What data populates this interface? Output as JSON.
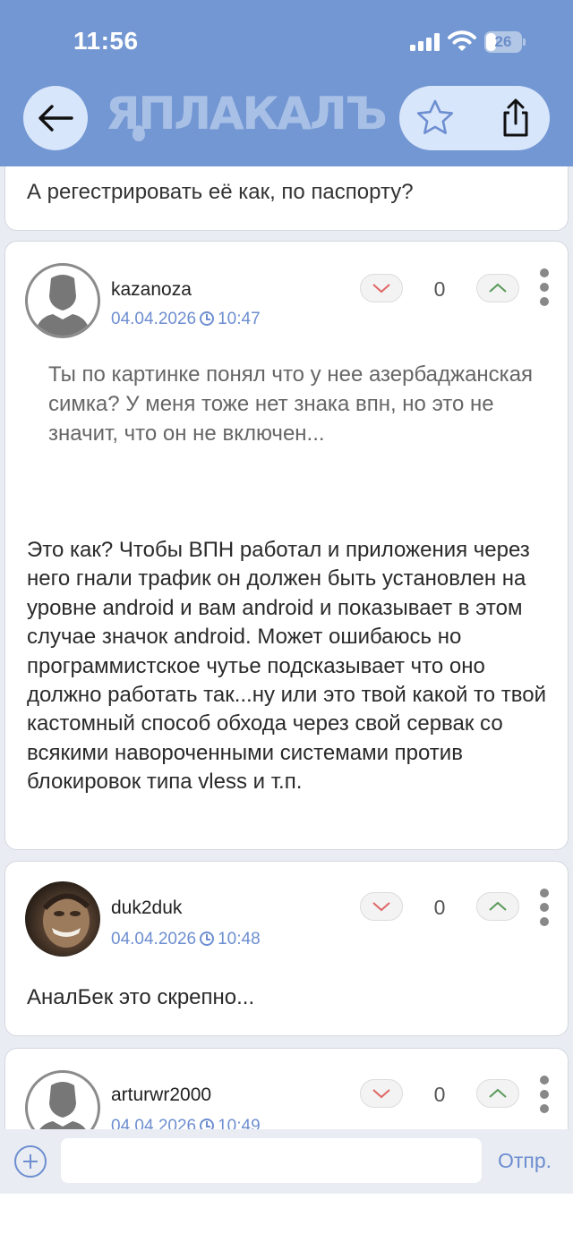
{
  "status_bar": {
    "time": "11:56",
    "battery": "26"
  },
  "header": {
    "logo_text": "ЯПЛАКАЛЪ"
  },
  "previous_comment": {
    "text": "А регестрировать её как, по паспорту?"
  },
  "comments": [
    {
      "username": "kazanoza",
      "date": "04.04.2026",
      "time": "10:47",
      "votes": "0",
      "quote": "Ты по картинке понял что у нее азербаджанская симка? У меня тоже нет знака впн, но это не значит, что он не включен...",
      "text": "Это как? Чтобы ВПН работал и приложения через него гнали трафик он должен быть установлен на уровне android и вам android и показывает в этом случае значок android. Может ошибаюсь но программистское чутье подсказывает что оно должно работать так...ну или это твой какой то твой кастомный способ обхода через свой сервак со всякими навороченными системами против блокировок типа vless и т.п."
    },
    {
      "username": "duk2duk",
      "date": "04.04.2026",
      "time": "10:48",
      "votes": "0",
      "text": "АналБек это скрепно..."
    },
    {
      "username": "arturwr2000",
      "date": "04.04.2026",
      "time": "10:49",
      "votes": "0"
    }
  ],
  "composer": {
    "placeholder": "",
    "send_label": "Отпр."
  },
  "colors": {
    "header": "#7397d2",
    "accent": "#6d8ed0",
    "background": "#e9ecf2"
  },
  "icons": [
    "back-arrow-icon",
    "star-icon",
    "share-icon",
    "vote-down-icon",
    "vote-up-icon",
    "more-vertical-icon",
    "clock-icon",
    "add-icon",
    "signal-icon",
    "wifi-icon",
    "battery-icon"
  ]
}
